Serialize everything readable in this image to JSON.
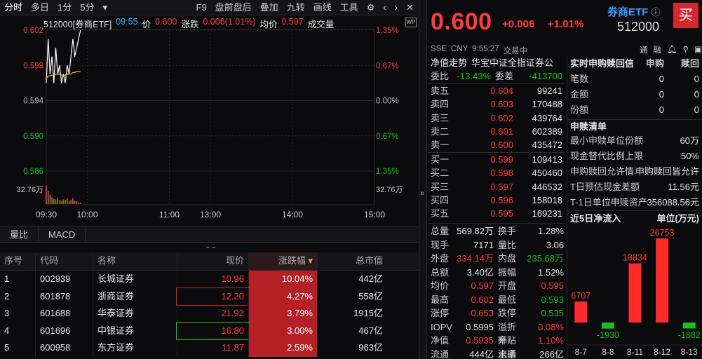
{
  "toolbar": {
    "items": [
      "分时",
      "多日",
      "1分",
      "5分",
      "F9",
      "盘前盘后",
      "叠加",
      "九转",
      "画线",
      "工具"
    ]
  },
  "quote_bar": {
    "code_name": "512000[券商ETF]",
    "time": "09:55",
    "price_label": "价",
    "price": "0.600",
    "change_label": "涨跌",
    "change": "0.006(1.01%)",
    "avg_label": "均价",
    "avg": "0.597",
    "volume_label": "成交量"
  },
  "chart_data": {
    "type": "line",
    "price_ticks": [
      "0.602",
      "0.598",
      "0.594",
      "0.590",
      "0.586"
    ],
    "pct_ticks": [
      "1.35%",
      "0.67%",
      "0.00%",
      "0.67%",
      "1.35%"
    ],
    "volume_tick": "32.76万",
    "x_ticks": [
      "09:30",
      "10:00",
      "11:00",
      "13:00",
      "14:00",
      "15:00"
    ],
    "ylim": [
      0.586,
      0.602
    ],
    "prev_close": 0.594,
    "price_series": [
      0.596,
      0.601,
      0.597,
      0.599,
      0.596,
      0.6,
      0.597,
      0.598,
      0.596,
      0.597,
      0.596,
      0.598,
      0.597,
      0.599,
      0.601,
      0.599,
      0.6,
      0.601,
      0.602
    ],
    "avg_series": [
      0.5965,
      0.5968,
      0.5968,
      0.5969,
      0.5969,
      0.597,
      0.597,
      0.597,
      0.5969,
      0.5969,
      0.5969,
      0.597,
      0.597,
      0.597,
      0.5972,
      0.5972,
      0.5973,
      0.5973,
      0.5973
    ],
    "volume_series": [
      28,
      20,
      14,
      10,
      8,
      7,
      9,
      6,
      5,
      7,
      6,
      8,
      5,
      6,
      9,
      5,
      4,
      3,
      2
    ],
    "volume_max": 32.76,
    "total_minutes": 240,
    "elapsed_minutes": 25
  },
  "subtabs": [
    "量比",
    "MACD"
  ],
  "list": {
    "headers": [
      "序号",
      "代码",
      "名称",
      "现价",
      "涨跌幅",
      "总市值"
    ],
    "rows": [
      {
        "seq": "1",
        "code": "002939",
        "name": "长城证券",
        "price": "10.96",
        "chg": "10.04%",
        "mcap": "442亿"
      },
      {
        "seq": "2",
        "code": "601878",
        "name": "浙商证券",
        "price": "12.20",
        "chg": "4.27%",
        "mcap": "558亿"
      },
      {
        "seq": "3",
        "code": "601688",
        "name": "华泰证券",
        "price": "21.92",
        "chg": "3.79%",
        "mcap": "1915亿"
      },
      {
        "seq": "4",
        "code": "601696",
        "name": "中银证券",
        "price": "16.80",
        "chg": "3.00%",
        "mcap": "467亿"
      },
      {
        "seq": "5",
        "code": "600958",
        "name": "东方证券",
        "price": "11.87",
        "chg": "2.59%",
        "mcap": "963亿"
      }
    ]
  },
  "header": {
    "price": "0.600",
    "change": "+0.006",
    "change_pct": "+1.01%",
    "name": "券商ETF",
    "code": "512000",
    "buy": "买",
    "exchange": "SSE",
    "currency": "CNY",
    "clock": "9:55:27",
    "status": "交易中",
    "icons": [
      "通",
      "融"
    ]
  },
  "book": {
    "tab1": "净值走势",
    "tab2": "华宝中证全指证券公",
    "weibi_label": "委比",
    "weibi": "-13.43%",
    "weicha_label": "委差",
    "weicha": "-413700",
    "asks": [
      {
        "label": "卖五",
        "price": "0.604",
        "vol": "99241"
      },
      {
        "label": "卖四",
        "price": "0.603",
        "vol": "170488"
      },
      {
        "label": "卖三",
        "price": "0.602",
        "vol": "439764"
      },
      {
        "label": "卖二",
        "price": "0.601",
        "vol": "602389"
      },
      {
        "label": "卖一",
        "price": "0.600",
        "vol": "435472"
      }
    ],
    "bids": [
      {
        "label": "买一",
        "price": "0.599",
        "vol": "109413"
      },
      {
        "label": "买二",
        "price": "0.598",
        "vol": "450460"
      },
      {
        "label": "买三",
        "price": "0.597",
        "vol": "446532"
      },
      {
        "label": "买四",
        "price": "0.596",
        "vol": "158018"
      },
      {
        "label": "买五",
        "price": "0.595",
        "vol": "169231"
      }
    ]
  },
  "stats": [
    {
      "l1": "总量",
      "v1": "569.82万",
      "c1": "white",
      "l2": "换手",
      "v2": "1.28%",
      "c2": "white"
    },
    {
      "l1": "现手",
      "v1": "7171",
      "c1": "white",
      "l2": "量比",
      "v2": "3.06",
      "c2": "white"
    },
    {
      "l1": "外盘",
      "v1": "334.14万",
      "c1": "red",
      "l2": "内盘",
      "v2": "235.68万",
      "c2": "green"
    },
    {
      "l1": "总额",
      "v1": "3.40亿",
      "c1": "white",
      "l2": "振幅",
      "v2": "1.52%",
      "c2": "white"
    },
    {
      "l1": "均价",
      "v1": "0.597",
      "c1": "red",
      "l2": "开盘",
      "v2": "0.595",
      "c2": "red"
    },
    {
      "l1": "最高",
      "v1": "0.602",
      "c1": "red",
      "l2": "最低",
      "v2": "0.593",
      "c2": "green"
    },
    {
      "l1": "涨停",
      "v1": "0.653",
      "c1": "red",
      "l2": "跌停",
      "v2": "0.535",
      "c2": "green"
    },
    {
      "l1": "IOPV",
      "v1": "0.5995",
      "c1": "white",
      "l2": "溢折率",
      "v2": "0.08%",
      "c2": "red"
    },
    {
      "l1": "净值",
      "v1": "0.5935",
      "c1": "red",
      "l2": "升贴水率",
      "v2": "1.10%",
      "c2": "red"
    },
    {
      "l1": "流通",
      "v1": "444亿",
      "c1": "white",
      "l2": "流通",
      "v2": "266亿",
      "c2": "white"
    }
  ],
  "redeem": {
    "title": "实时申购赎回信息",
    "col1": "申购",
    "col2": "赎回",
    "rows": [
      {
        "label": "笔数",
        "v1": "0",
        "v2": "0"
      },
      {
        "label": "金额",
        "v1": "0",
        "v2": "0"
      },
      {
        "label": "份额",
        "v1": "0",
        "v2": "0"
      }
    ]
  },
  "list_info": {
    "title": "申赎清单",
    "rows": [
      {
        "label": "最小申赎单位份额",
        "value": "60万"
      },
      {
        "label": "现金替代比例上限",
        "value": "50%"
      },
      {
        "label": "申购赎回允许情况",
        "value": "申购赎回皆允许"
      },
      {
        "label": "T日预估现金差额",
        "value": "11.56元"
      },
      {
        "label": "T-1日单位申赎资产",
        "value": "356088.56元"
      }
    ]
  },
  "flow": {
    "title": "近5日净流入",
    "unit": "单位(万元)",
    "dates": [
      "8-7",
      "8-8",
      "8-11",
      "8-12",
      "8-13"
    ],
    "values": [
      6707,
      -1930,
      18834,
      26753,
      -1882
    ],
    "labels": [
      "6707",
      "-1930",
      "18834",
      "26753",
      "-1882"
    ]
  }
}
